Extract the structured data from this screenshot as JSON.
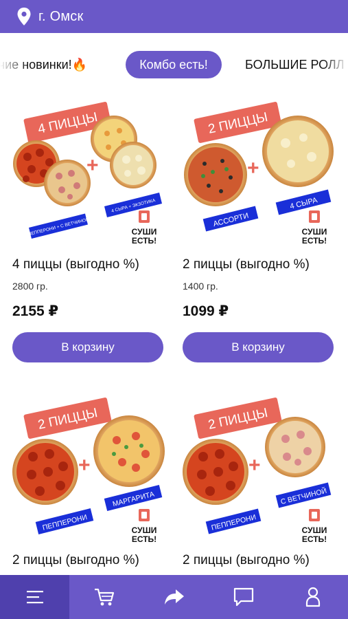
{
  "header": {
    "city": "г. Омск",
    "pin_icon": "location-pin-icon"
  },
  "categories": [
    {
      "label": "Горячие новинки!🔥",
      "visible": "ячие новинки!🔥",
      "active": false
    },
    {
      "label": "Комбо есть!",
      "active": true
    },
    {
      "label": "БОЛЬШИЕ РОЛЛЫ",
      "visible": "БОЛЬШИЕ РОЛЛ",
      "active": false
    }
  ],
  "products": [
    {
      "name": "4 пиццы (выгодно %)",
      "weight": "2800 гр.",
      "price": "2155 ₽",
      "button": "В корзину",
      "banner": "4 ПИЦЦЫ",
      "tag_left": "ПЕППЕРОНИ + С ВЕТЧИНОЙ",
      "tag_right": "4 СЫРА + ЭКЗОТИКА",
      "logo_top": "СУШИ",
      "logo_bottom": "ЕСТЬ!"
    },
    {
      "name": "2 пиццы (выгодно %)",
      "weight": "1400 гр.",
      "price": "1099 ₽",
      "button": "В корзину",
      "banner": "2 ПИЦЦЫ",
      "tag_left": "АССОРТИ",
      "tag_right": "4 СЫРА",
      "logo_top": "СУШИ",
      "logo_bottom": "ЕСТЬ!"
    },
    {
      "name": "2 пиццы (выгодно %)",
      "banner": "2 ПИЦЦЫ",
      "tag_left": "ПЕППЕРОНИ",
      "tag_right": "МАРГАРИТА",
      "logo_top": "СУШИ",
      "logo_bottom": "ЕСТЬ!"
    },
    {
      "name": "2 пиццы (выгодно %)",
      "banner": "2 ПИЦЦЫ",
      "tag_left": "ПЕППЕРОНИ",
      "tag_right": "С ВЕТЧИНОЙ",
      "logo_top": "СУШИ",
      "logo_bottom": "ЕСТЬ!"
    }
  ],
  "bottom_nav": [
    {
      "icon": "menu-icon",
      "active": true
    },
    {
      "icon": "cart-icon",
      "active": false
    },
    {
      "icon": "share-icon",
      "active": false
    },
    {
      "icon": "chat-icon",
      "active": false
    },
    {
      "icon": "profile-icon",
      "active": false
    }
  ],
  "colors": {
    "accent": "#6a58c8",
    "banner": "#e8675a",
    "tag": "#1a2fd8"
  }
}
